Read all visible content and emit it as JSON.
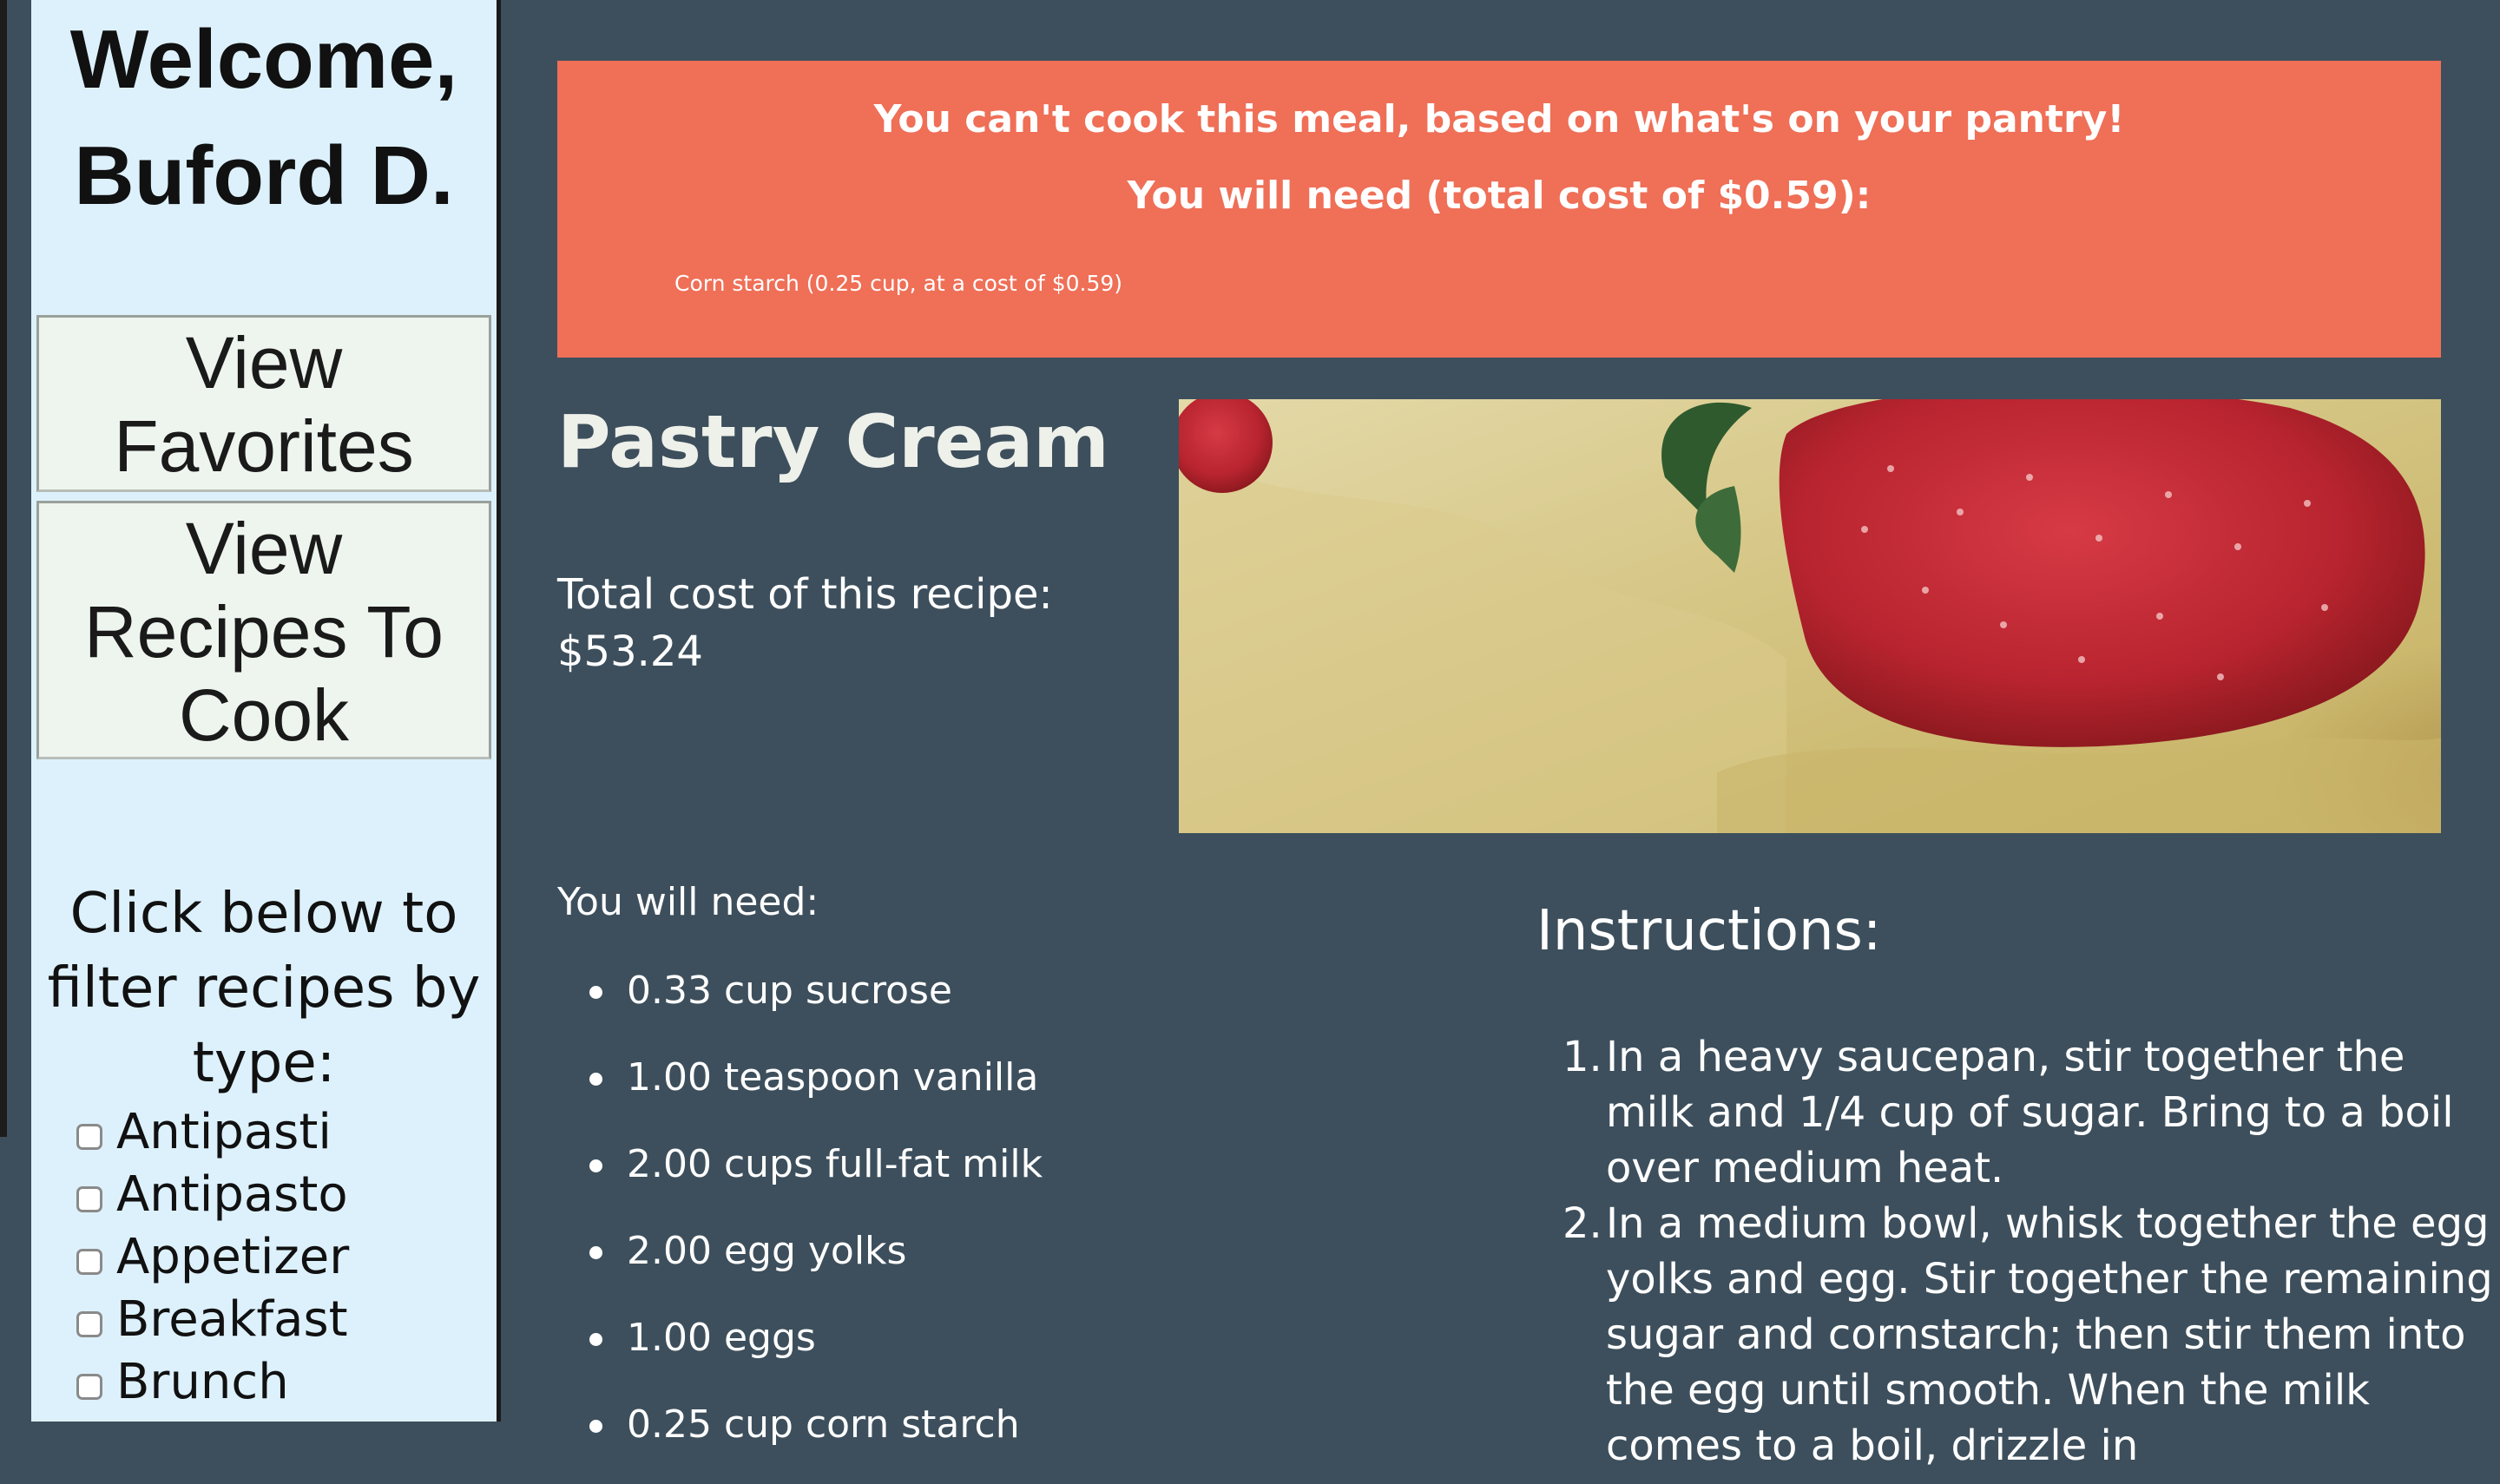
{
  "sidebar": {
    "welcome_line1": "Welcome,",
    "welcome_line2": "Buford D.",
    "view_favorites": "View Favorites",
    "view_recipes_to_cook": "View Recipes To Cook",
    "filter_prompt": "Click below to filter recipes by type:",
    "filters": [
      "Antipasti",
      "Antipasto",
      "Appetizer",
      "Breakfast",
      "Brunch"
    ]
  },
  "alert": {
    "headline": "You can't cook this meal, based on what's on your pantry!",
    "need_total": "You will need (total cost of $0.59):",
    "missing_items": [
      "Corn starch (0.25 cup, at a cost of $0.59)"
    ]
  },
  "recipe": {
    "title": "Pastry Cream",
    "cost_label": "Total cost of this recipe:",
    "cost_value": "$53.24",
    "need_label": "You will need:",
    "ingredients": [
      "0.33 cup sucrose",
      "1.00 teaspoon vanilla",
      "2.00 cups full-fat milk",
      "2.00 egg yolks",
      "1.00 eggs",
      "0.25 cup corn starch"
    ],
    "instructions_title": "Instructions:",
    "steps": [
      "In a heavy saucepan, stir together the milk and 1/4 cup of sugar. Bring to a boil over medium heat.",
      "In a medium bowl, whisk together the egg yolks and egg. Stir together the remaining sugar and cornstarch; then stir them into the egg until smooth. When the milk comes to a boil, drizzle in"
    ]
  },
  "colors": {
    "page_bg": "#3d4f5c",
    "sidebar_bg": "#ddf1fd",
    "alert_bg": "#ef6f57"
  }
}
